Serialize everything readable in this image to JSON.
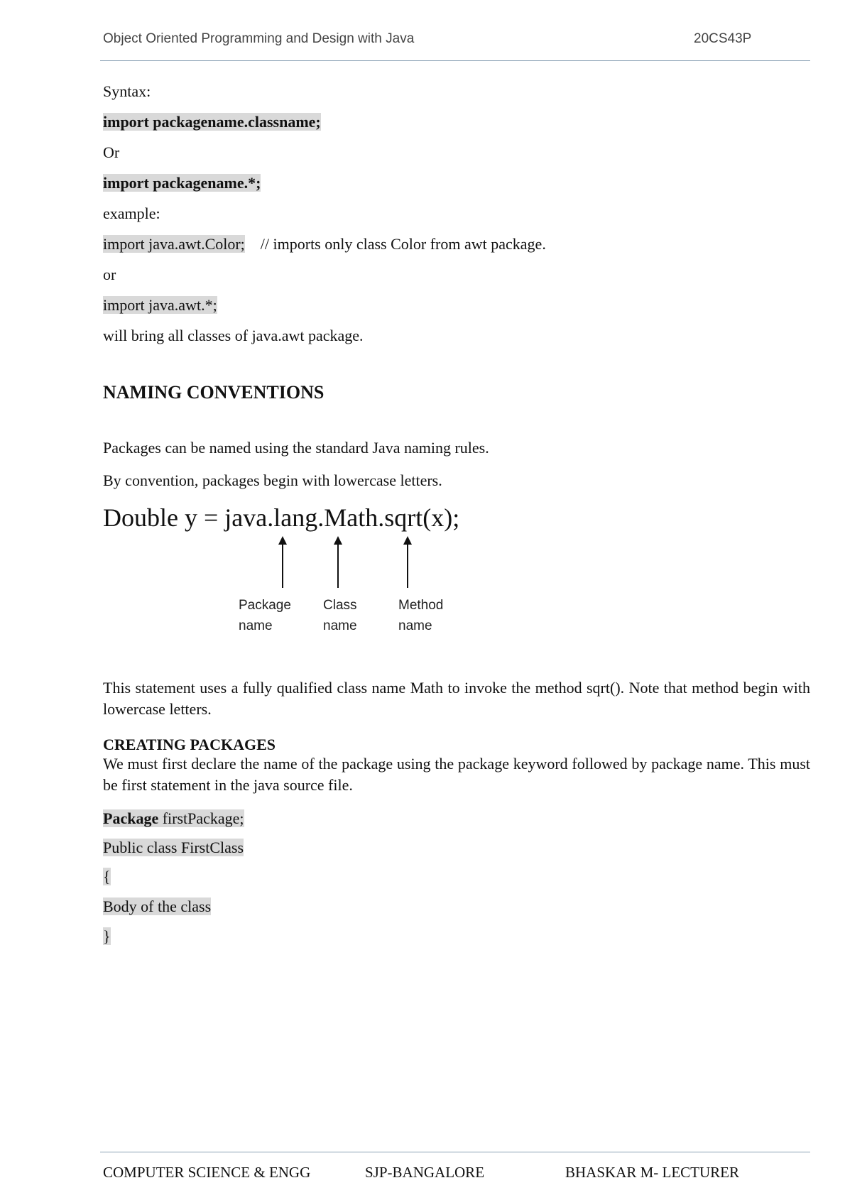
{
  "header": {
    "title": "Object Oriented Programming and Design with Java",
    "code": "20CS43P"
  },
  "syntax": {
    "label": "Syntax:",
    "line1": "import packagename.classname;",
    "or1": "Or",
    "line2": "import packagename.*;",
    "example_label": "example:",
    "ex1_code": "import java.awt.Color;",
    "ex1_comment": "// imports only class Color from awt package.",
    "or2": "or",
    "ex2_code": "import java.awt.*;",
    "ex2_desc": "will bring all classes of java.awt package."
  },
  "naming": {
    "heading": "NAMING CONVENTIONS",
    "p1": "Packages can be named using the standard Java naming rules.",
    "p2": "By convention, packages begin with lowercase letters.",
    "statement": "Double y = java.lang.Math.sqrt(x);",
    "labels": [
      {
        "line1": "Package",
        "line2": "name"
      },
      {
        "line1": "Class",
        "line2": "name"
      },
      {
        "line1": "Method",
        "line2": "name"
      }
    ],
    "explanation": "This statement uses a fully qualified class name Math to invoke the method sqrt(). Note that method begin with lowercase letters."
  },
  "creating": {
    "heading": "CREATING  PACKAGES",
    "text": "We must first declare the name of the package using the package keyword followed by package name. This must be first statement in the java source file.",
    "code_keyword": "Package",
    "code_line1_rest": " firstPackage;",
    "code_line2": "Public class FirstClass",
    "code_open": "{",
    "code_body": "Body of the class",
    "code_close": "}"
  },
  "footer": {
    "dept": "COMPUTER SCIENCE & ENGG",
    "college": "SJP-BANGALORE",
    "author": "BHASKAR M- LECTURER"
  }
}
